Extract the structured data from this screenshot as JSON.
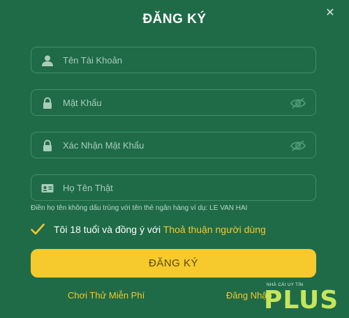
{
  "title": "ĐĂNG KÝ",
  "fields": [
    {
      "placeholder": "Tên Tài Khoản",
      "icon": "user-icon"
    },
    {
      "placeholder": "Mật Khẩu",
      "icon": "lock-icon"
    },
    {
      "placeholder": "Xác Nhận Mật Khẩu",
      "icon": "lock-icon"
    },
    {
      "placeholder": "Họ Tên Thật",
      "icon": "id-card-icon"
    }
  ],
  "hint": "Điền họ tên không dấu trùng với tên thẻ ngân hàng ví dụ: LE VAN HAI",
  "agree": {
    "checked": true,
    "text": "Tôi 18 tuổi và đồng ý với",
    "link": "Thoả thuận người dùng"
  },
  "submit_label": "ĐĂNG KÝ",
  "footer": {
    "try_free": "Chơi Thử Miễn Phí",
    "login": "Đăng Nhập"
  },
  "watermark": {
    "small": "NHÀ CÁI UY TÍN",
    "big": "PLUS"
  },
  "colors": {
    "background": "#1f6b48",
    "accent": "#f6ca2d",
    "border": "#3f8f68"
  }
}
